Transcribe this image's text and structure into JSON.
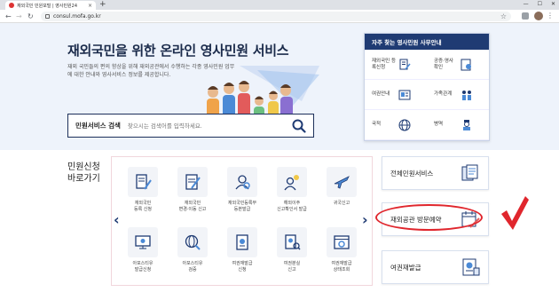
{
  "browser": {
    "tab_title": "재외국민 민원포털 | 영사민원24",
    "tab_close": "×",
    "new_tab": "+",
    "url": "consul.mofa.go.kr",
    "win_controls": [
      "—",
      "☐",
      "✕"
    ]
  },
  "hero": {
    "title": "재외국민을 위한 온라인 영사민원 서비스",
    "description": "재외 국민들의 편의 향상을 위해 재외공관에서 수행하는 각종 영사민원 업무에 대한 안내와 영사서비스 정보를 제공합니다."
  },
  "search": {
    "label": "민원서비스 검색",
    "placeholder": "찾으시는 검색어를 입력하세요."
  },
  "quick_panel": {
    "title": "자주 찾는 영사민원 사무안내",
    "items": [
      {
        "label": "재외국민 등록신청",
        "icon": "document-pen-icon"
      },
      {
        "label": "공증·영사 확인",
        "icon": "stamp-icon"
      },
      {
        "label": "여권안내",
        "icon": "passport-icon"
      },
      {
        "label": "가족관계",
        "icon": "family-icon"
      },
      {
        "label": "국적",
        "icon": "globe-icon"
      },
      {
        "label": "병역",
        "icon": "soldier-icon"
      }
    ]
  },
  "shortcuts": {
    "title_line1": "민원신청",
    "title_line2": "바로가기",
    "prev": "‹",
    "next": "›",
    "items": [
      {
        "label": "재외국민\n등록 신청",
        "icon": "document-pen-icon"
      },
      {
        "label": "재외국민\n변경·이동 신고",
        "icon": "edit-document-icon"
      },
      {
        "label": "재외국민등록부\n등본발급",
        "icon": "person-search-icon"
      },
      {
        "label": "해외이주\n신고확인서 발급",
        "icon": "idea-person-icon"
      },
      {
        "label": "귀국신고",
        "icon": "airplane-icon"
      },
      {
        "label": "아포스티유\n발급신청",
        "icon": "monitor-icon"
      },
      {
        "label": "아포스티유\n검증",
        "icon": "globe-search-icon"
      },
      {
        "label": "여권재발급\n신청",
        "icon": "passport-icon"
      },
      {
        "label": "여권분실\n신고",
        "icon": "passport-search-icon"
      },
      {
        "label": "여권재발급\n상태조회",
        "icon": "browser-icon"
      }
    ]
  },
  "service_cards": [
    {
      "label": "전체민원서비스",
      "icon": "documents-icon"
    },
    {
      "label": "재외공관 방문예약",
      "icon": "calendar-pen-icon"
    },
    {
      "label": "여권재발급",
      "icon": "passport-icon"
    }
  ],
  "colors": {
    "navy": "#1f3b73",
    "annotation_red": "#e0262d"
  }
}
